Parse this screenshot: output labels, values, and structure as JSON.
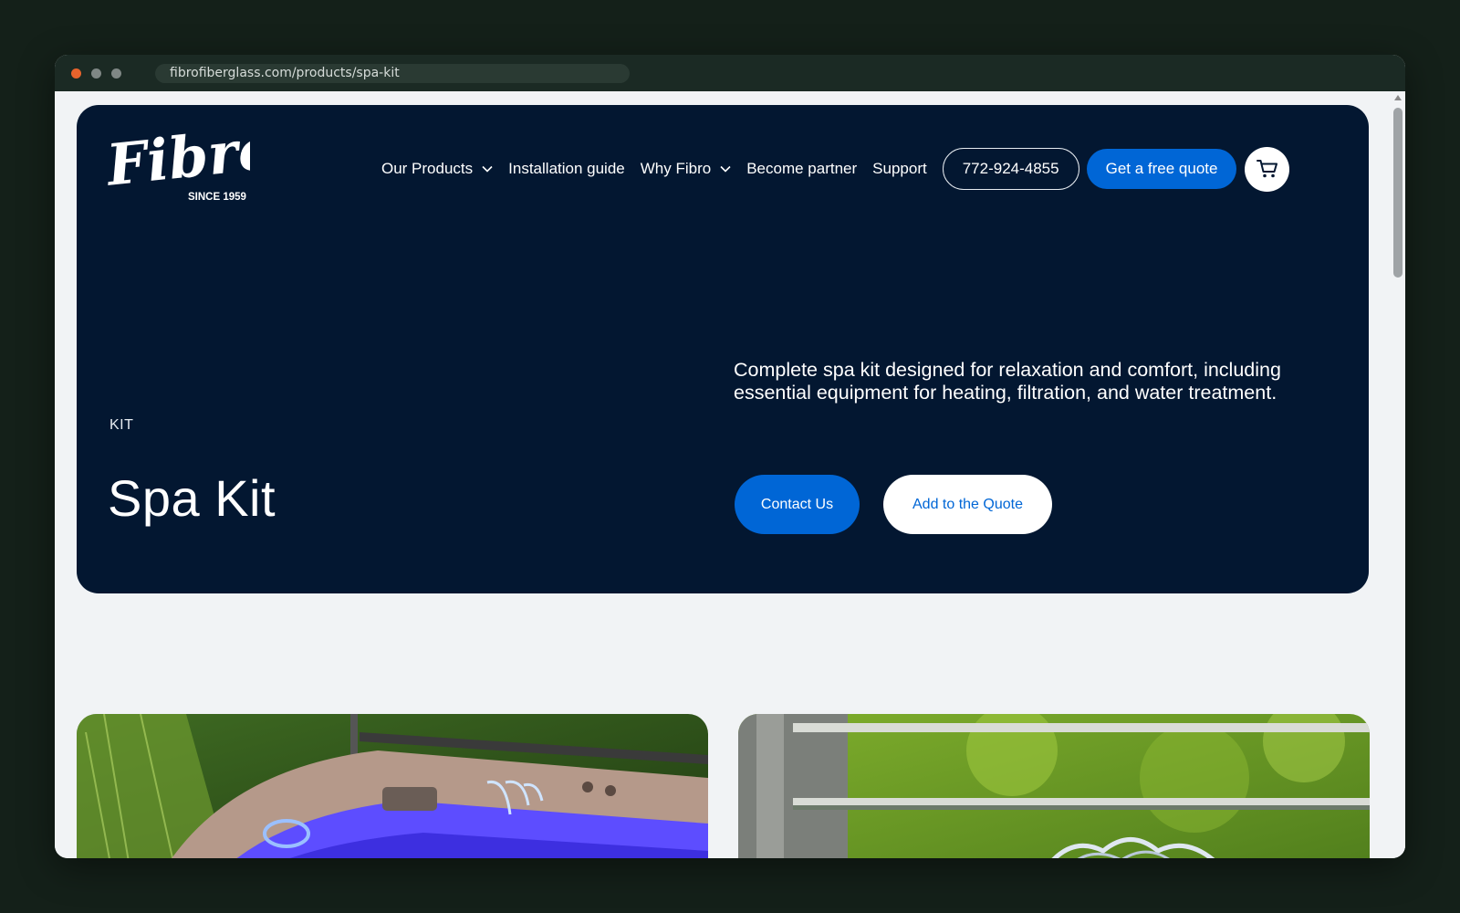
{
  "browser": {
    "url": "fibrofiberglass.com/products/spa-kit",
    "dots": [
      "#e8632c",
      "#7f8785",
      "#7f8785"
    ]
  },
  "logo": {
    "wordmark": "Fibro",
    "tagline": "SINCE 1959"
  },
  "nav": {
    "items": [
      {
        "label": "Our Products",
        "has_dropdown": true
      },
      {
        "label": "Installation guide",
        "has_dropdown": false
      },
      {
        "label": "Why Fibro",
        "has_dropdown": true
      },
      {
        "label": "Become partner",
        "has_dropdown": false
      },
      {
        "label": "Support",
        "has_dropdown": false
      }
    ],
    "phone": "772-924-4855",
    "quote_label": "Get a free quote",
    "cart_icon": "cart-icon"
  },
  "hero": {
    "eyebrow": "KIT",
    "title": "Spa Kit",
    "description": "Complete spa kit designed for relaxation and comfort, including essential equipment for heating, filtration, and water treatment.",
    "contact_label": "Contact Us",
    "add_quote_label": "Add to the Quote"
  },
  "colors": {
    "hero_bg": "#031731",
    "accent": "#0066d6",
    "page_bg": "#f1f3f5"
  },
  "gallery": [
    {
      "subject": "spa-tub-photo"
    },
    {
      "subject": "garden-fountain-photo"
    }
  ]
}
